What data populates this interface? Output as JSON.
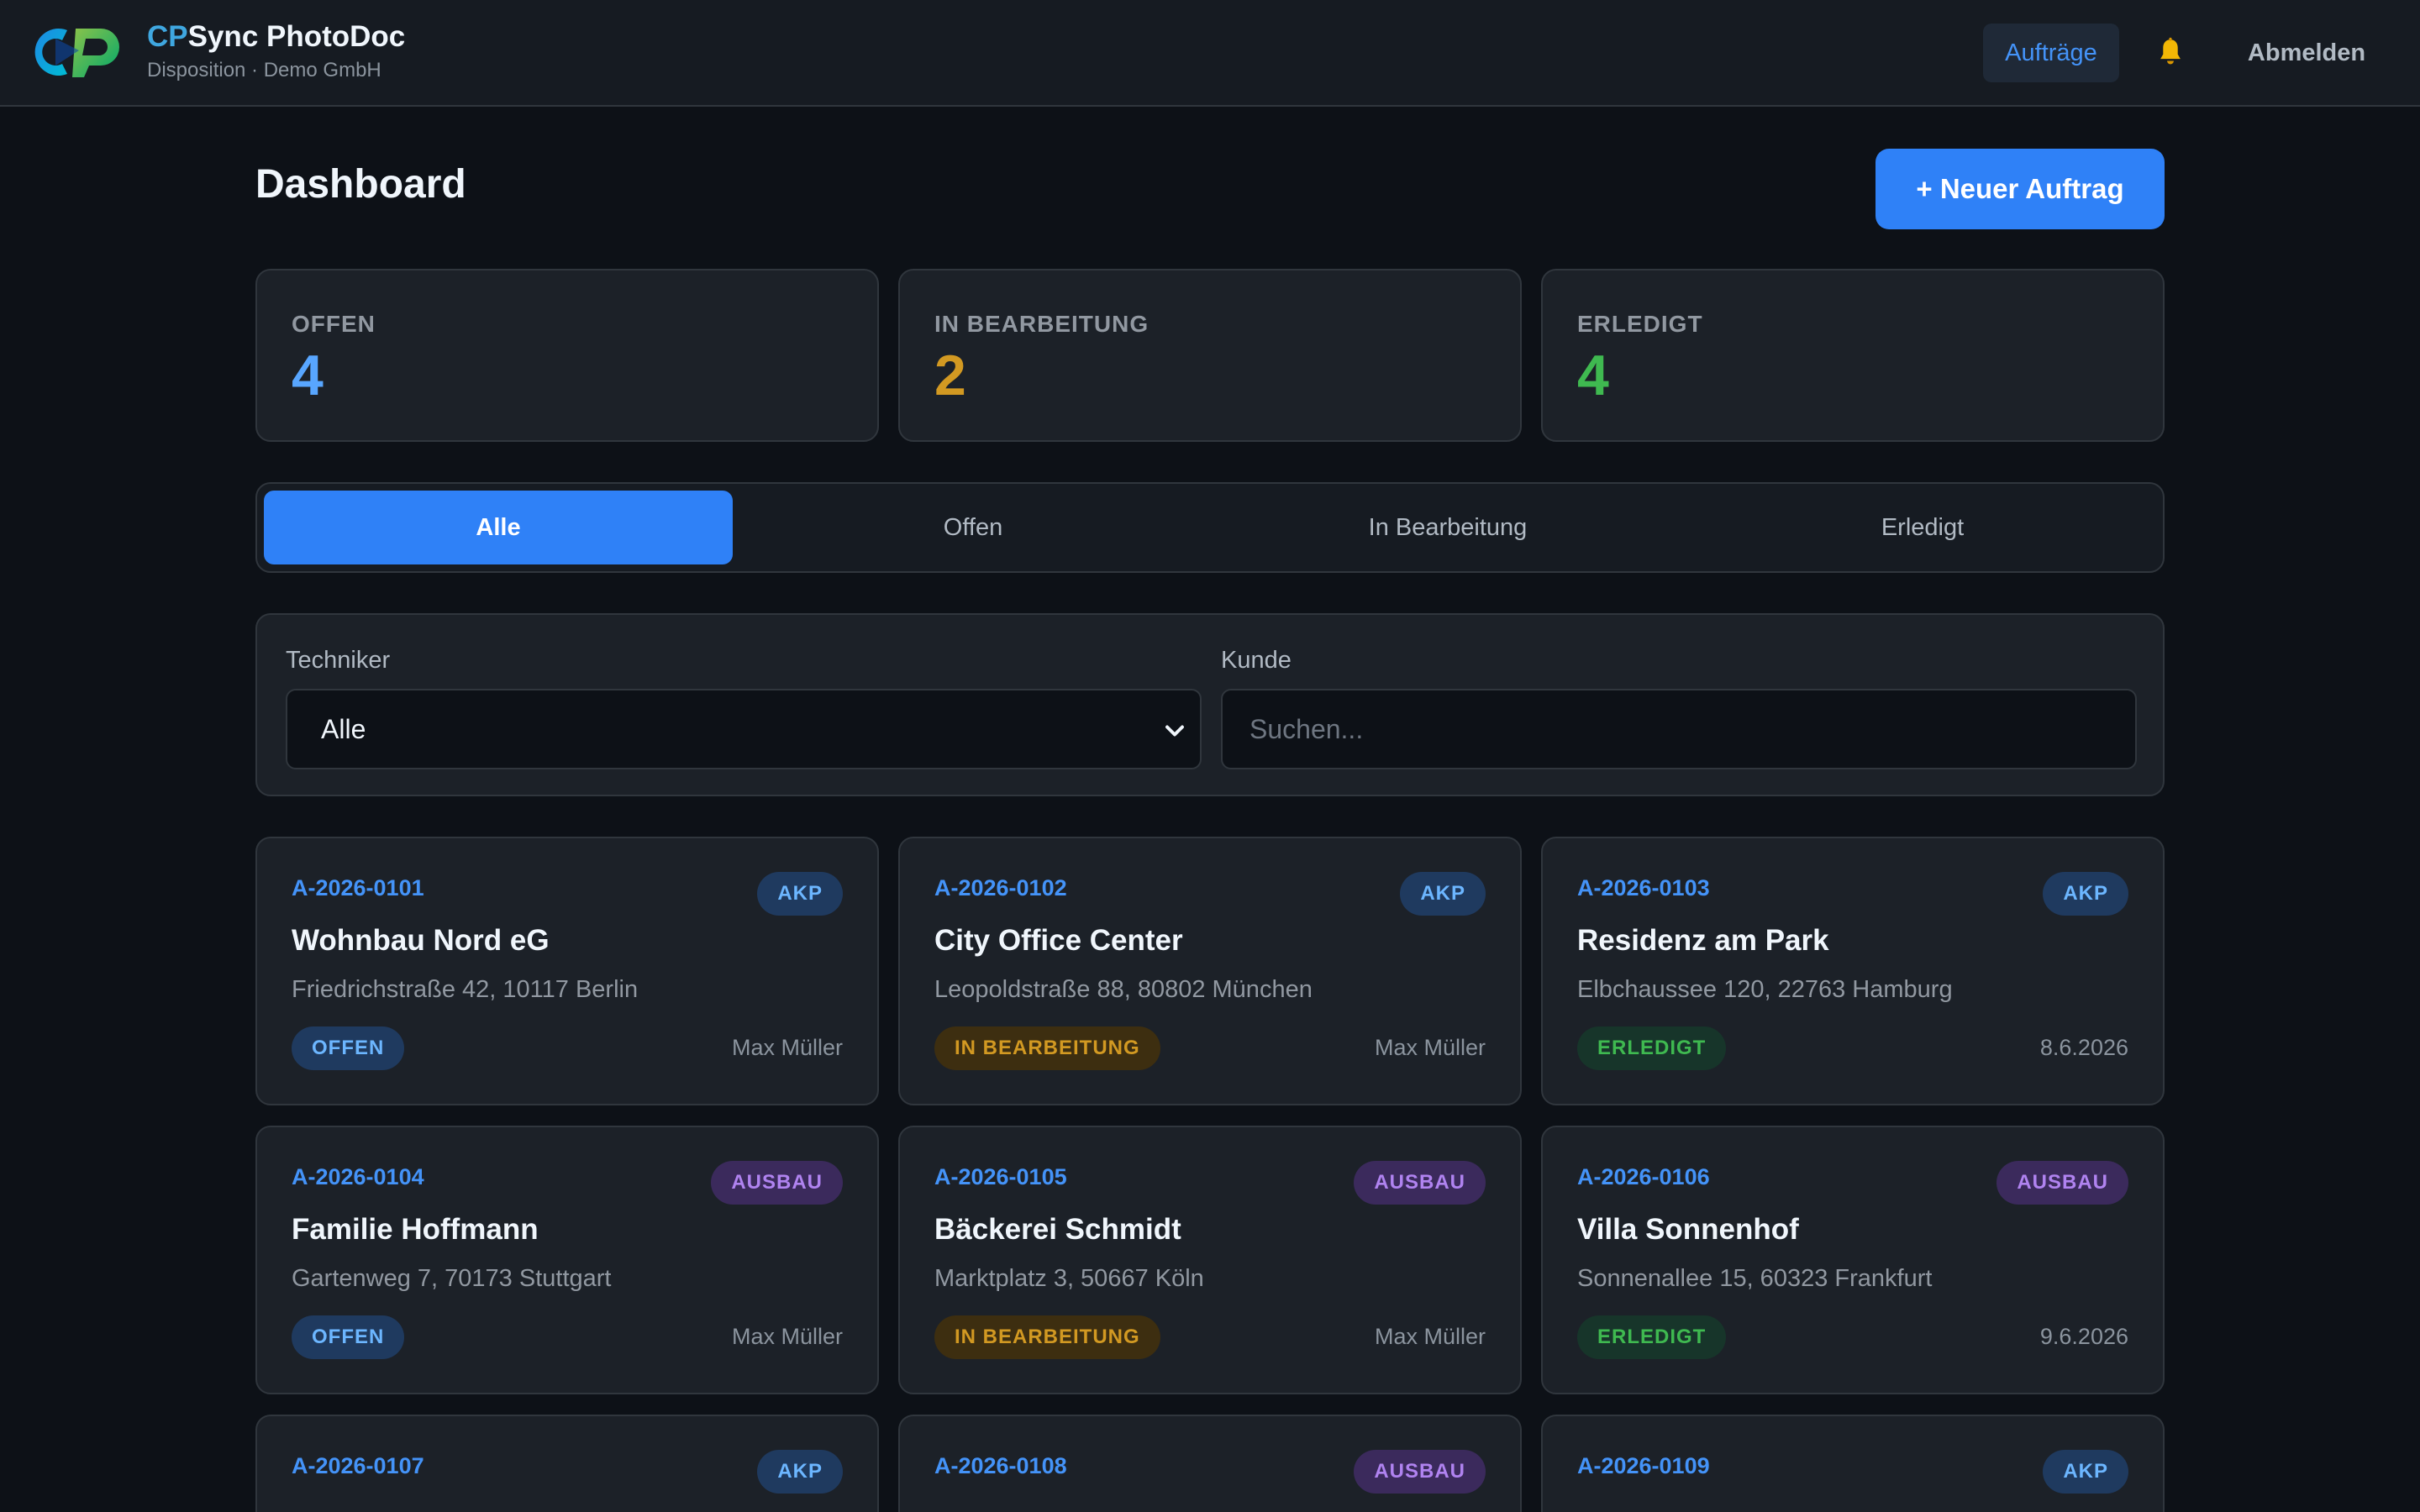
{
  "header": {
    "brand_prefix": "CP",
    "brand_rest": "Sync PhotoDoc",
    "subtitle": "Disposition · Demo GmbH",
    "nav_orders": "Aufträge",
    "logout": "Abmelden"
  },
  "page": {
    "title": "Dashboard",
    "new_order": "+ Neuer Auftrag"
  },
  "stats": [
    {
      "label": "OFFEN",
      "value": "4",
      "color": "#58a6ff"
    },
    {
      "label": "IN BEARBEITUNG",
      "value": "2",
      "color": "#d29922"
    },
    {
      "label": "ERLEDIGT",
      "value": "4",
      "color": "#3fb950"
    }
  ],
  "tabs": [
    "Alle",
    "Offen",
    "In Bearbeitung",
    "Erledigt"
  ],
  "filters": {
    "technician_label": "Techniker",
    "technician_value": "Alle",
    "customer_label": "Kunde",
    "customer_placeholder": "Suchen..."
  },
  "orders": [
    {
      "id": "A-2026-0101",
      "type": "AKP",
      "title": "Wohnbau Nord eG",
      "address": "Friedrichstraße 42, 10117 Berlin",
      "status": "OFFEN",
      "meta": "Max Müller"
    },
    {
      "id": "A-2026-0102",
      "type": "AKP",
      "title": "City Office Center",
      "address": "Leopoldstraße 88, 80802 München",
      "status": "IN BEARBEITUNG",
      "meta": "Max Müller"
    },
    {
      "id": "A-2026-0103",
      "type": "AKP",
      "title": "Residenz am Park",
      "address": "Elbchaussee 120, 22763 Hamburg",
      "status": "ERLEDIGT",
      "meta": "8.6.2026"
    },
    {
      "id": "A-2026-0104",
      "type": "AUSBAU",
      "title": "Familie Hoffmann",
      "address": "Gartenweg 7, 70173 Stuttgart",
      "status": "OFFEN",
      "meta": "Max Müller"
    },
    {
      "id": "A-2026-0105",
      "type": "AUSBAU",
      "title": "Bäckerei Schmidt",
      "address": "Marktplatz 3, 50667 Köln",
      "status": "IN BEARBEITUNG",
      "meta": "Max Müller"
    },
    {
      "id": "A-2026-0106",
      "type": "AUSBAU",
      "title": "Villa Sonnenhof",
      "address": "Sonnenallee 15, 60323 Frankfurt",
      "status": "ERLEDIGT",
      "meta": "9.6.2026"
    },
    {
      "id": "A-2026-0107",
      "type": "AKP"
    },
    {
      "id": "A-2026-0108",
      "type": "AUSBAU"
    },
    {
      "id": "A-2026-0109",
      "type": "AKP"
    }
  ]
}
